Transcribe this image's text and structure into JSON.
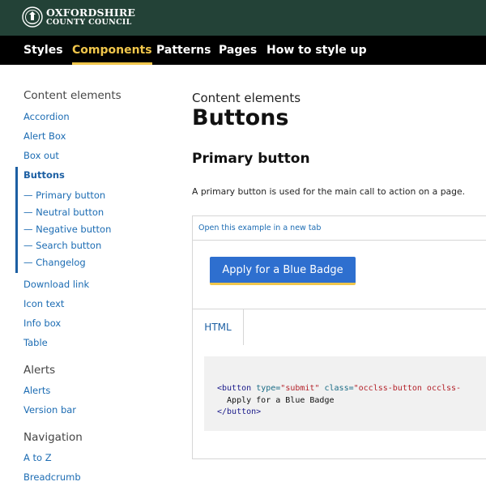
{
  "header": {
    "logo_line1": "OXFORDSHIRE",
    "logo_line2": "COUNTY COUNCIL",
    "bg_color": "#234237"
  },
  "nav": {
    "items": [
      {
        "label": "Styles"
      },
      {
        "label": "Components"
      },
      {
        "label": "Patterns"
      },
      {
        "label": "Pages"
      },
      {
        "label": "How to style up"
      }
    ],
    "active": "Components",
    "active_color": "#f0c64b"
  },
  "sidebar": {
    "content_heading": "Content elements",
    "content_links": [
      {
        "label": "Accordion"
      },
      {
        "label": "Alert Box"
      },
      {
        "label": "Box out"
      },
      {
        "label": "Buttons"
      }
    ],
    "buttons_subitems": [
      {
        "label": "— Primary button"
      },
      {
        "label": "— Neutral button"
      },
      {
        "label": "— Negative button"
      },
      {
        "label": "— Search button"
      },
      {
        "label": "— Changelog"
      }
    ],
    "more_content_links": [
      {
        "label": "Download link"
      },
      {
        "label": "Icon text"
      },
      {
        "label": "Info box"
      },
      {
        "label": "Table"
      }
    ],
    "alerts_heading": "Alerts",
    "alerts_links": [
      {
        "label": "Alerts"
      },
      {
        "label": "Version bar"
      }
    ],
    "navigation_heading": "Navigation",
    "navigation_links": [
      {
        "label": "A to Z"
      },
      {
        "label": "Breadcrumb"
      }
    ]
  },
  "main": {
    "kicker": "Content elements",
    "title": "Buttons",
    "section_heading": "Primary button",
    "description": "A primary button is used for the main call to action on a page.",
    "example": {
      "open_link": "Open this example in a new tab",
      "button_label": "Apply for a Blue Badge",
      "button_color": "#2e6fcf",
      "tab_label": "HTML",
      "code": {
        "open_tag": "<button",
        "attr1_name": "type=",
        "attr1_value": "\"submit\"",
        "attr2_name": "class=",
        "attr2_value": "\"occlss-button occlss-",
        "inner_text": "  Apply for a Blue Badge",
        "close_tag": "</button>"
      }
    }
  }
}
